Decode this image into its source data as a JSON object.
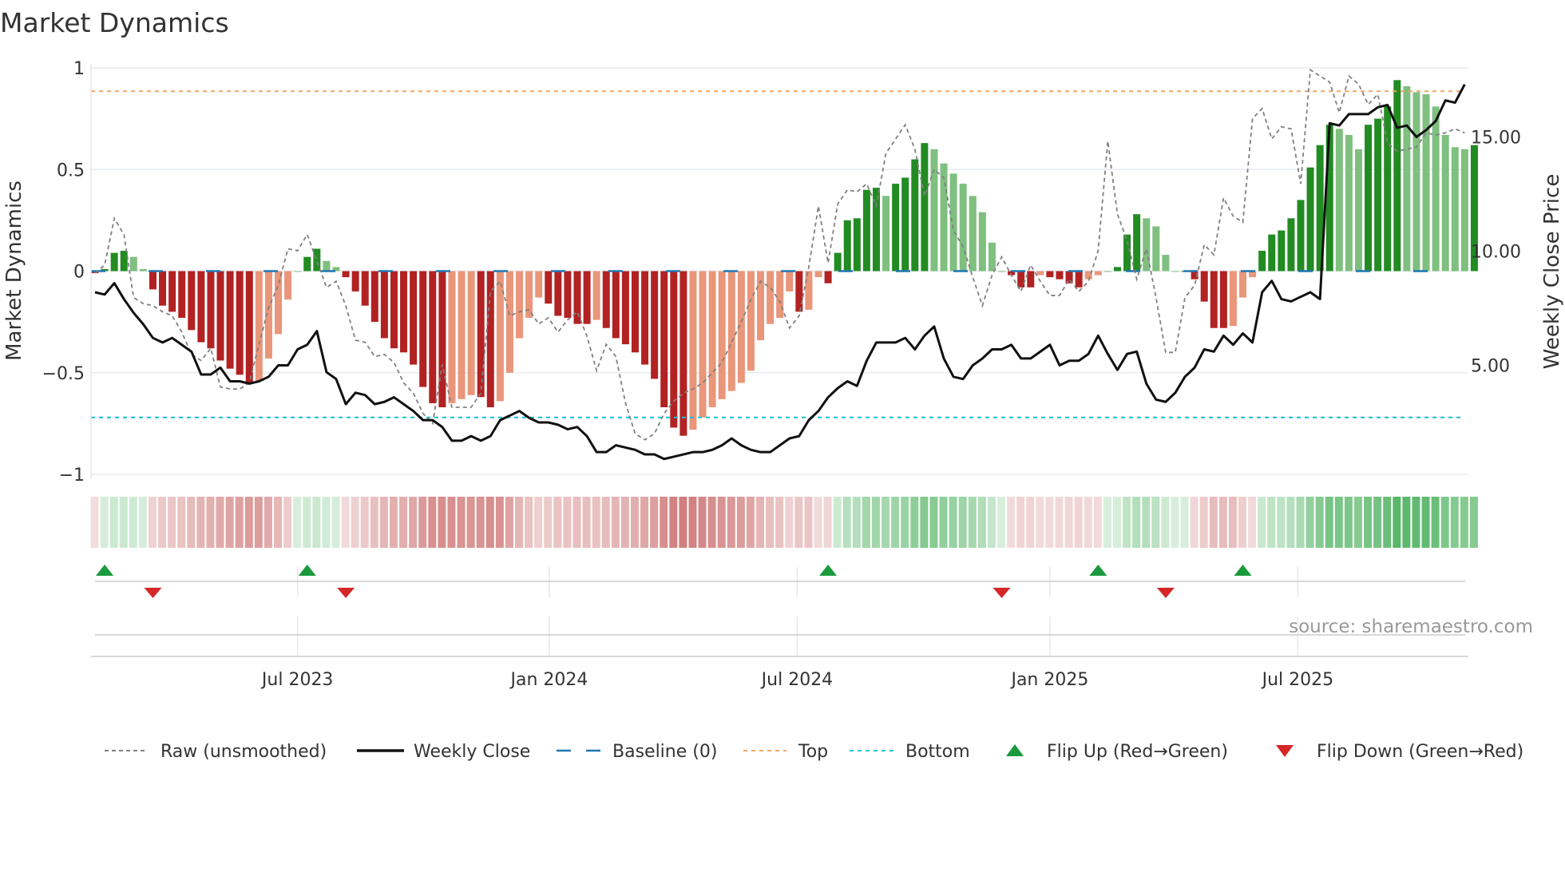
{
  "chart_data": {
    "type": "bar",
    "title": "Market Dynamics",
    "ylabel": "Market Dynamics",
    "ylabel_right": "Weekly Close Price",
    "ylim": [
      -1,
      1
    ],
    "ylim_right": [
      0.25,
      18.0
    ],
    "yticks": [
      {
        "v": 1,
        "label": "1"
      },
      {
        "v": 0.5,
        "label": "0.5"
      },
      {
        "v": 0,
        "label": "0"
      },
      {
        "v": -0.5,
        "label": "−0.5"
      },
      {
        "v": -1,
        "label": "−1"
      }
    ],
    "yticks_right": [
      {
        "v": 15,
        "label": "15.00"
      },
      {
        "v": 10,
        "label": "10.00"
      },
      {
        "v": 5,
        "label": "5.00"
      }
    ],
    "xticks": [
      {
        "week": 21.0,
        "label": "Jul 2023"
      },
      {
        "week": 47.1,
        "label": "Jan 2024"
      },
      {
        "week": 72.8,
        "label": "Jul 2024"
      },
      {
        "week": 99.0,
        "label": "Jan 2025"
      },
      {
        "week": 124.7,
        "label": "Jul 2025"
      }
    ],
    "top_level": 0.885,
    "bottom_level": -0.72,
    "baseline": 0,
    "values": [
      -0.01,
      0.01,
      0.09,
      0.1,
      0.07,
      0.01,
      -0.09,
      -0.17,
      -0.2,
      -0.23,
      -0.29,
      -0.35,
      -0.38,
      -0.44,
      -0.48,
      -0.51,
      -0.55,
      -0.54,
      -0.43,
      -0.31,
      -0.14,
      0.0,
      0.07,
      0.11,
      0.05,
      0.02,
      -0.03,
      -0.1,
      -0.17,
      -0.25,
      -0.33,
      -0.38,
      -0.4,
      -0.46,
      -0.57,
      -0.65,
      -0.67,
      -0.65,
      -0.63,
      -0.61,
      -0.62,
      -0.67,
      -0.64,
      -0.5,
      -0.33,
      -0.23,
      -0.13,
      -0.16,
      -0.22,
      -0.23,
      -0.26,
      -0.26,
      -0.24,
      -0.28,
      -0.33,
      -0.36,
      -0.4,
      -0.46,
      -0.53,
      -0.67,
      -0.77,
      -0.81,
      -0.78,
      -0.72,
      -0.67,
      -0.63,
      -0.59,
      -0.55,
      -0.49,
      -0.34,
      -0.26,
      -0.23,
      -0.1,
      -0.2,
      -0.19,
      -0.03,
      -0.06,
      0.09,
      0.25,
      0.26,
      0.4,
      0.41,
      0.37,
      0.43,
      0.46,
      0.55,
      0.63,
      0.6,
      0.53,
      0.48,
      0.43,
      0.37,
      0.29,
      0.14,
      0.0,
      -0.02,
      -0.08,
      -0.08,
      -0.02,
      -0.03,
      -0.04,
      -0.06,
      -0.08,
      -0.04,
      -0.02,
      0.0,
      0.02,
      0.18,
      0.28,
      0.26,
      0.22,
      0.08,
      0.0,
      0.0,
      -0.04,
      -0.15,
      -0.28,
      -0.28,
      -0.27,
      -0.13,
      -0.03,
      0.1,
      0.18,
      0.2,
      0.26,
      0.35,
      0.51,
      0.62,
      0.72,
      0.7,
      0.67,
      0.6,
      0.72,
      0.75,
      0.81,
      0.94,
      0.91,
      0.88,
      0.87,
      0.81,
      0.67,
      0.61,
      0.6,
      0.62
    ],
    "raw": [
      -0.01,
      0.03,
      0.26,
      0.18,
      -0.13,
      -0.16,
      -0.17,
      -0.2,
      -0.22,
      -0.3,
      -0.41,
      -0.44,
      -0.38,
      -0.57,
      -0.58,
      -0.58,
      -0.55,
      -0.36,
      -0.18,
      -0.07,
      0.11,
      0.1,
      0.18,
      0.05,
      -0.08,
      -0.05,
      -0.17,
      -0.34,
      -0.35,
      -0.42,
      -0.41,
      -0.45,
      -0.55,
      -0.6,
      -0.7,
      -0.75,
      -0.46,
      -0.67,
      -0.67,
      -0.67,
      -0.6,
      -0.1,
      -0.05,
      -0.22,
      -0.2,
      -0.19,
      -0.26,
      -0.23,
      -0.3,
      -0.24,
      -0.2,
      -0.32,
      -0.49,
      -0.36,
      -0.42,
      -0.65,
      -0.8,
      -0.83,
      -0.8,
      -0.7,
      -0.64,
      -0.6,
      -0.58,
      -0.55,
      -0.5,
      -0.45,
      -0.35,
      -0.25,
      -0.14,
      -0.05,
      -0.08,
      -0.15,
      -0.28,
      -0.22,
      0.02,
      0.32,
      0.04,
      0.33,
      0.4,
      0.39,
      0.43,
      0.32,
      0.58,
      0.65,
      0.72,
      0.6,
      0.37,
      0.5,
      0.46,
      0.2,
      0.12,
      -0.03,
      -0.17,
      -0.02,
      0.07,
      -0.02,
      -0.1,
      0.03,
      -0.05,
      -0.12,
      -0.12,
      -0.04,
      -0.1,
      -0.05,
      0.1,
      0.64,
      0.28,
      0.15,
      -0.04,
      0.11,
      -0.13,
      -0.4,
      -0.4,
      -0.13,
      -0.07,
      0.13,
      0.08,
      0.36,
      0.27,
      0.24,
      0.75,
      0.8,
      0.65,
      0.71,
      0.7,
      0.43,
      0.99,
      0.96,
      0.93,
      0.78,
      0.96,
      0.92,
      0.82,
      0.87,
      0.63,
      0.59,
      0.6,
      0.61,
      0.68,
      0.67,
      0.68,
      0.7,
      0.68
    ],
    "weekly_close": [
      8.2,
      8.1,
      8.6,
      7.9,
      7.3,
      6.8,
      6.2,
      6.0,
      6.2,
      5.9,
      5.6,
      4.6,
      4.6,
      4.9,
      4.3,
      4.3,
      4.2,
      4.3,
      4.5,
      5.0,
      5.0,
      5.7,
      5.9,
      6.5,
      4.7,
      4.4,
      3.3,
      3.8,
      3.7,
      3.3,
      3.4,
      3.6,
      3.3,
      3.0,
      2.6,
      2.6,
      2.3,
      1.7,
      1.7,
      1.9,
      1.7,
      1.9,
      2.6,
      2.8,
      3.0,
      2.7,
      2.5,
      2.5,
      2.4,
      2.2,
      2.3,
      1.9,
      1.2,
      1.2,
      1.5,
      1.4,
      1.3,
      1.1,
      1.1,
      0.9,
      1.0,
      1.1,
      1.2,
      1.2,
      1.3,
      1.5,
      1.8,
      1.5,
      1.3,
      1.2,
      1.2,
      1.5,
      1.8,
      1.9,
      2.6,
      3.0,
      3.6,
      4.0,
      4.3,
      4.1,
      5.2,
      6.0,
      6.0,
      6.0,
      6.2,
      5.7,
      6.3,
      6.7,
      5.3,
      4.5,
      4.4,
      5.0,
      5.3,
      5.7,
      5.7,
      5.9,
      5.3,
      5.3,
      5.6,
      5.9,
      5.0,
      5.2,
      5.2,
      5.5,
      6.3,
      5.5,
      4.8,
      5.5,
      5.6,
      4.2,
      3.5,
      3.4,
      3.8,
      4.5,
      4.9,
      5.7,
      5.6,
      6.3,
      5.9,
      6.4,
      6.0,
      8.2,
      8.7,
      7.9,
      7.8,
      8.0,
      8.2,
      7.9,
      15.6,
      15.5,
      16.0,
      16.0,
      16.0,
      16.3,
      16.4,
      15.4,
      15.5,
      15.0,
      15.3,
      15.7,
      16.6,
      16.5,
      17.3
    ],
    "flip_up_weeks": [
      1,
      22,
      76,
      104,
      119
    ],
    "flip_down_weeks": [
      6,
      26,
      94,
      111
    ],
    "legend": [
      "Raw (unsmoothed)",
      "Weekly Close",
      "Baseline (0)",
      "Top",
      "Bottom",
      "Flip Up (Red→Green)",
      "Flip Down (Green→Red)"
    ],
    "legend_placement": "bottom",
    "grid": true,
    "source": "source: sharemaestro.com"
  },
  "colors": {
    "bar_pos_strong": "#228b22",
    "bar_pos_weak": "#7fbf7f",
    "bar_neg_strong": "#b22222",
    "bar_neg_weak": "#e9967a",
    "raw": "#808080",
    "close": "#111111",
    "baseline": "#1f77b4",
    "top": "#f4a460",
    "bottom": "#17becf",
    "flip_up": "#1a9a3c",
    "flip_down": "#d62728"
  }
}
